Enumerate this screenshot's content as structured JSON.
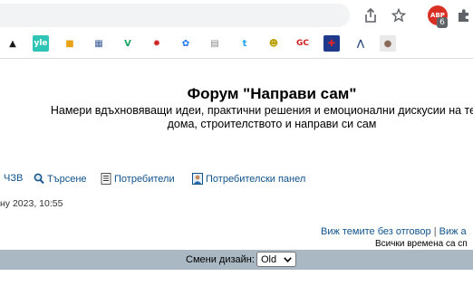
{
  "browser": {
    "extension_badge_label": "ABP",
    "extension_badge_count": "6",
    "icons": [
      "share-icon",
      "star-icon",
      "adblock-icon",
      "extensions-puzzle-icon"
    ]
  },
  "bookmarks": [
    {
      "name": "bookmark-hat",
      "glyph": "▲",
      "bg": "#ffffff",
      "fg": "#1a1a1a"
    },
    {
      "name": "bookmark-yle",
      "glyph": "yle",
      "bg": "#2ec4b6",
      "fg": "#ffffff"
    },
    {
      "name": "bookmark-bag",
      "glyph": "■",
      "bg": "#ffffff",
      "fg": "#e8a317"
    },
    {
      "name": "bookmark-grid",
      "glyph": "▦",
      "bg": "#ffffff",
      "fg": "#3b5b9a"
    },
    {
      "name": "bookmark-v",
      "glyph": "V",
      "bg": "#ffffff",
      "fg": "#1aa260"
    },
    {
      "name": "bookmark-bulb",
      "glyph": "✹",
      "bg": "#ffffff",
      "fg": "#cc2222"
    },
    {
      "name": "bookmark-gear",
      "glyph": "✿",
      "bg": "#ffffff",
      "fg": "#1a73e8"
    },
    {
      "name": "bookmark-news",
      "glyph": "▤",
      "bg": "#ffffff",
      "fg": "#888888"
    },
    {
      "name": "bookmark-t",
      "glyph": "t",
      "bg": "#ffffff",
      "fg": "#1da1f2"
    },
    {
      "name": "bookmark-smiley",
      "glyph": "☻",
      "bg": "#ffffff",
      "fg": "#b8a000"
    },
    {
      "name": "bookmark-gc",
      "glyph": "GC",
      "bg": "#ffffff",
      "fg": "#d11f1f"
    },
    {
      "name": "bookmark-uk-flag",
      "glyph": "✚",
      "bg": "#1f3a8a",
      "fg": "#e0242a"
    },
    {
      "name": "bookmark-mountain",
      "glyph": "⋀",
      "bg": "#ffffff",
      "fg": "#2b4a7d"
    },
    {
      "name": "bookmark-person",
      "glyph": "●",
      "bg": "#e9e9e9",
      "fg": "#8a6b5a"
    }
  ],
  "forum": {
    "title": "Форум \"Направи сам\"",
    "description_line1": "Намери вдъхновяващи идеи, практични решения и емоционални дискусии на теми,",
    "description_line2": "дома, строителството и направи си сам"
  },
  "nav": {
    "faq": "ЧЗВ",
    "search": "Търсене",
    "members": "Потребители",
    "ucp": "Потребителски панел"
  },
  "date_text": "ну 2023, 10:55",
  "links": {
    "unanswered": "Виж темите без отговор",
    "separator": "|",
    "active_partial": "Виж а",
    "timezone": "Всички времена са сп"
  },
  "style_switcher": {
    "label": "Смени дизайн:",
    "selected": "Old"
  },
  "colors": {
    "link": "#105289",
    "style_band": "#a9b8c2"
  }
}
